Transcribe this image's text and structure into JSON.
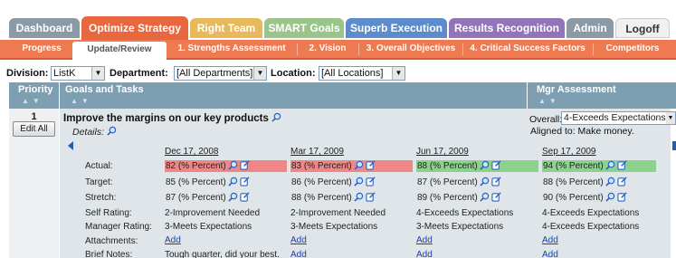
{
  "nav": {
    "tabs": [
      {
        "label": "Dashboard",
        "color": "#8b9aa5"
      },
      {
        "label": "Optimize Strategy",
        "color": "#e8673f",
        "active": true
      },
      {
        "label": "Right Team",
        "color": "#e8b85a"
      },
      {
        "label": "SMART Goals",
        "color": "#9bc48a"
      },
      {
        "label": "Superb Execution",
        "color": "#5d8ccd"
      },
      {
        "label": "Results Recognition",
        "color": "#9175b8"
      },
      {
        "label": "Admin",
        "color": "#8b9aa5"
      },
      {
        "label": "Logoff",
        "color": "#f0f0f0"
      }
    ],
    "subtabs": [
      {
        "label": "Progress"
      },
      {
        "label": "Update/Review",
        "active": true
      },
      {
        "label": "1. Strengths Assessment"
      },
      {
        "label": "2. Vision"
      },
      {
        "label": "3. Overall Objectives"
      },
      {
        "label": "4. Critical Success Factors"
      },
      {
        "label": "Competitors"
      }
    ]
  },
  "filters": {
    "division_label": "Division:",
    "division_value": "ListK",
    "department_label": "Department:",
    "department_value": "[All Departments]",
    "location_label": "Location:",
    "location_value": "[All Locations]"
  },
  "columns": {
    "priority": "Priority",
    "goals": "Goals and Tasks",
    "mgr": "Mgr Assessment"
  },
  "goal": {
    "priority": "1",
    "edit_all": "Edit All",
    "title": "Improve the margins on our key products",
    "details_label": "Details:",
    "overall_label": "Overall:",
    "overall_value": "4-Exceeds Expectations",
    "aligned": "Aligned to: Make money."
  },
  "row_labels": {
    "actual": "Actual:",
    "target": "Target:",
    "stretch": "Stretch:",
    "self_rating": "Self Rating:",
    "manager_rating": "Manager Rating:",
    "attachments": "Attachments:",
    "brief_notes": "Brief Notes:"
  },
  "periods": [
    {
      "date": "Dec 17, 2008",
      "actual": "82 (% Percent)",
      "actual_status": "red",
      "target": "85 (% Percent)",
      "stretch": "87 (% Percent)",
      "self_rating": "2-Improvement Needed",
      "manager_rating": "3-Meets Expectations",
      "attachment": "Add",
      "notes": "Tough quarter, did your best."
    },
    {
      "date": "Mar 17, 2009",
      "actual": "83 (% Percent)",
      "actual_status": "red",
      "target": "86 (% Percent)",
      "stretch": "88 (% Percent)",
      "self_rating": "2-Improvement Needed",
      "manager_rating": "3-Meets Expectations",
      "attachment": "Add",
      "notes": ""
    },
    {
      "date": "Jun 17, 2009",
      "actual": "88 (% Percent)",
      "actual_status": "green",
      "target": "87 (% Percent)",
      "stretch": "89 (% Percent)",
      "self_rating": "4-Exceeds Expectations",
      "manager_rating": "3-Meets Expectations",
      "attachment": "Add",
      "notes": ""
    },
    {
      "date": "Sep 17, 2009",
      "actual": "94 (% Percent)",
      "actual_status": "green",
      "target": "88 (% Percent)",
      "stretch": "90 (% Percent)",
      "self_rating": "4-Exceeds Expectations",
      "manager_rating": "4-Exceeds Expectations",
      "attachment": "Add",
      "notes": ""
    }
  ],
  "colors": {
    "accent": "#e8673f",
    "header": "#7e9fb2",
    "behind": "#ef8787",
    "ahead": "#8cd18c"
  }
}
